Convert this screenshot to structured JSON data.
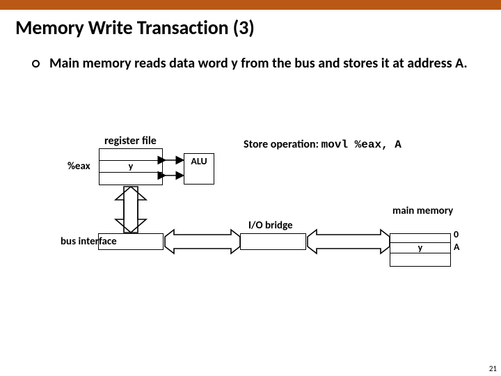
{
  "title": "Memory Write Transaction (3)",
  "bullet": "Main memory reads data word y from the bus and stores it at address A.",
  "labels": {
    "register_file": "register file",
    "eax": "%eax",
    "reg_value": "y",
    "alu": "ALU",
    "bus_interface": "bus interface",
    "io_bridge": "I/O bridge",
    "main_memory": "main memory",
    "mem_zero": "0",
    "mem_value": "y",
    "mem_addr": "A"
  },
  "store_op": {
    "prefix": "Store operation:",
    "code": "movl %eax, A"
  },
  "page_number": "21"
}
